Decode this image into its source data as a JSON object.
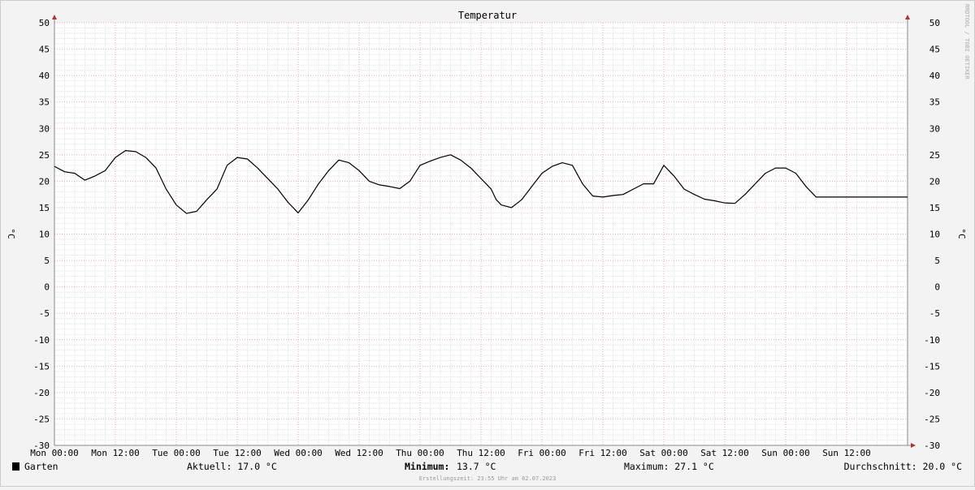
{
  "chart_data": {
    "type": "line",
    "title": "Temperatur",
    "ylabel": "°C",
    "ylim": [
      -30,
      50
    ],
    "yticks": [
      50,
      45,
      40,
      35,
      30,
      25,
      20,
      15,
      10,
      5,
      0,
      -5,
      -10,
      -15,
      -20,
      -25,
      -30
    ],
    "xticks": [
      "Mon 00:00",
      "Mon 12:00",
      "Tue 00:00",
      "Tue 12:00",
      "Wed 00:00",
      "Wed 12:00",
      "Thu 00:00",
      "Thu 12:00",
      "Fri 00:00",
      "Fri 12:00",
      "Sat 00:00",
      "Sat 12:00",
      "Sun 00:00",
      "Sun 12:00"
    ],
    "x_unit": "hours since Mon 00:00",
    "grid": true,
    "series": [
      {
        "name": "Garten",
        "color": "#000000",
        "x": [
          0,
          2,
          4,
          6,
          8,
          10,
          12,
          14,
          16,
          18,
          20,
          22,
          24,
          26,
          28,
          30,
          32,
          34,
          36,
          38,
          40,
          42,
          44,
          46,
          48,
          50,
          52,
          54,
          56,
          58,
          60,
          62,
          64,
          66,
          68,
          70,
          72,
          74,
          76,
          78,
          80,
          82,
          84,
          85,
          86,
          87,
          88,
          90,
          92,
          94,
          96,
          98,
          100,
          102,
          104,
          106,
          108,
          110,
          112,
          114,
          116,
          118,
          120,
          122,
          124,
          126,
          128,
          130,
          132,
          134,
          136,
          138,
          140,
          142,
          144,
          146,
          148,
          150,
          152,
          154,
          156,
          158,
          160,
          162,
          164,
          166,
          168
        ],
        "values": [
          22.8,
          21.8,
          21.5,
          20.2,
          21.0,
          22.0,
          24.5,
          25.8,
          25.6,
          24.5,
          22.5,
          18.5,
          15.5,
          13.9,
          14.3,
          16.5,
          18.5,
          23.0,
          24.5,
          24.2,
          22.5,
          20.5,
          18.5,
          16.0,
          14.0,
          16.5,
          19.5,
          22.0,
          24.0,
          23.5,
          22.0,
          20.0,
          19.3,
          19.0,
          18.6,
          20.0,
          23.0,
          23.8,
          24.5,
          25.0,
          24.0,
          22.5,
          20.5,
          19.5,
          18.5,
          16.5,
          15.5,
          15.0,
          16.5,
          19.0,
          21.5,
          22.8,
          23.5,
          23.0,
          19.5,
          17.2,
          17.0,
          17.3,
          17.5,
          18.5,
          19.5,
          19.5,
          23.0,
          21.0,
          18.5,
          17.5,
          16.6,
          16.3,
          15.9,
          15.8,
          17.5,
          19.5,
          21.5,
          22.5,
          22.5,
          21.5,
          19.0,
          17.0,
          17.0,
          17.0,
          17.0,
          17.0,
          17.0,
          17.0,
          17.0,
          17.0,
          17.0
        ]
      }
    ]
  },
  "legend": {
    "series_name": "Garten",
    "current": "Aktuell: 17.0 °C",
    "minimum_label": "Minimum:",
    "minimum_value": "13.7 °C",
    "maximum": "Maximum: 27.1 °C",
    "average": "Durchschnitt: 20.0 °C"
  },
  "footer": "Erstellungszeit: 23:55 Uhr am 02.07.2023",
  "watermark": "RRDTOOL / TOBI OETIKER"
}
